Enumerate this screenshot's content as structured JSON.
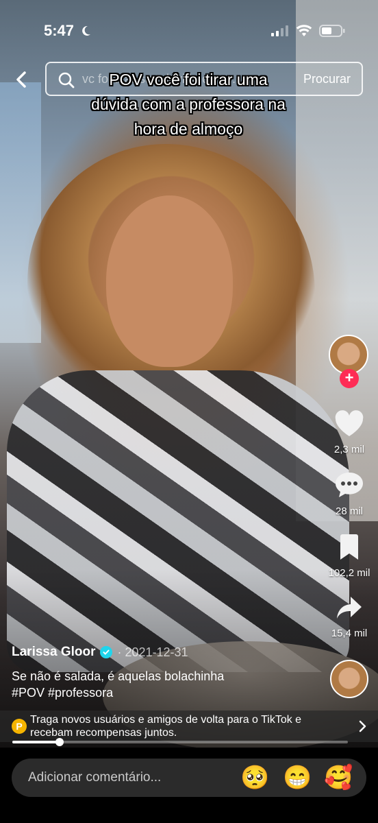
{
  "status_bar": {
    "time": "5:47",
    "moon_icon": "moon-icon",
    "signal_icon": "cellular-signal-icon",
    "wifi_icon": "wifi-icon",
    "battery_icon": "battery-icon"
  },
  "search": {
    "query_text": "vc foi tirar sua duvida com...",
    "submit_label": "Procurar"
  },
  "video": {
    "caption_line_1": "POV você foi tirar uma",
    "caption_line_2": "dúvida com a professora na",
    "caption_line_3": "hora de almoço"
  },
  "side_rail": {
    "likes": "2,3 mil",
    "comments": "28 mil",
    "saves": "102,2 mil",
    "shares": "15,4 mil",
    "follow_symbol": "+"
  },
  "post": {
    "author": "Larissa Gloor",
    "date": "· 2021-12-31",
    "description": "Se não é salada, é aquelas bolachinha",
    "hashtags": "#POV #professora"
  },
  "promo": {
    "coin_letter": "P",
    "text": "Traga novos usuários e amigos de volta para o TikTok e recebam recompensas juntos."
  },
  "playback": {
    "progress_fraction": 0.14
  },
  "comment_bar": {
    "placeholder": "Adicionar comentário...",
    "emoji_1": "🥺",
    "emoji_2": "😁",
    "emoji_3": "🥰"
  },
  "colors": {
    "follow": "#fe2c55",
    "verified": "#20d5ec",
    "coin": "#f5b400"
  }
}
